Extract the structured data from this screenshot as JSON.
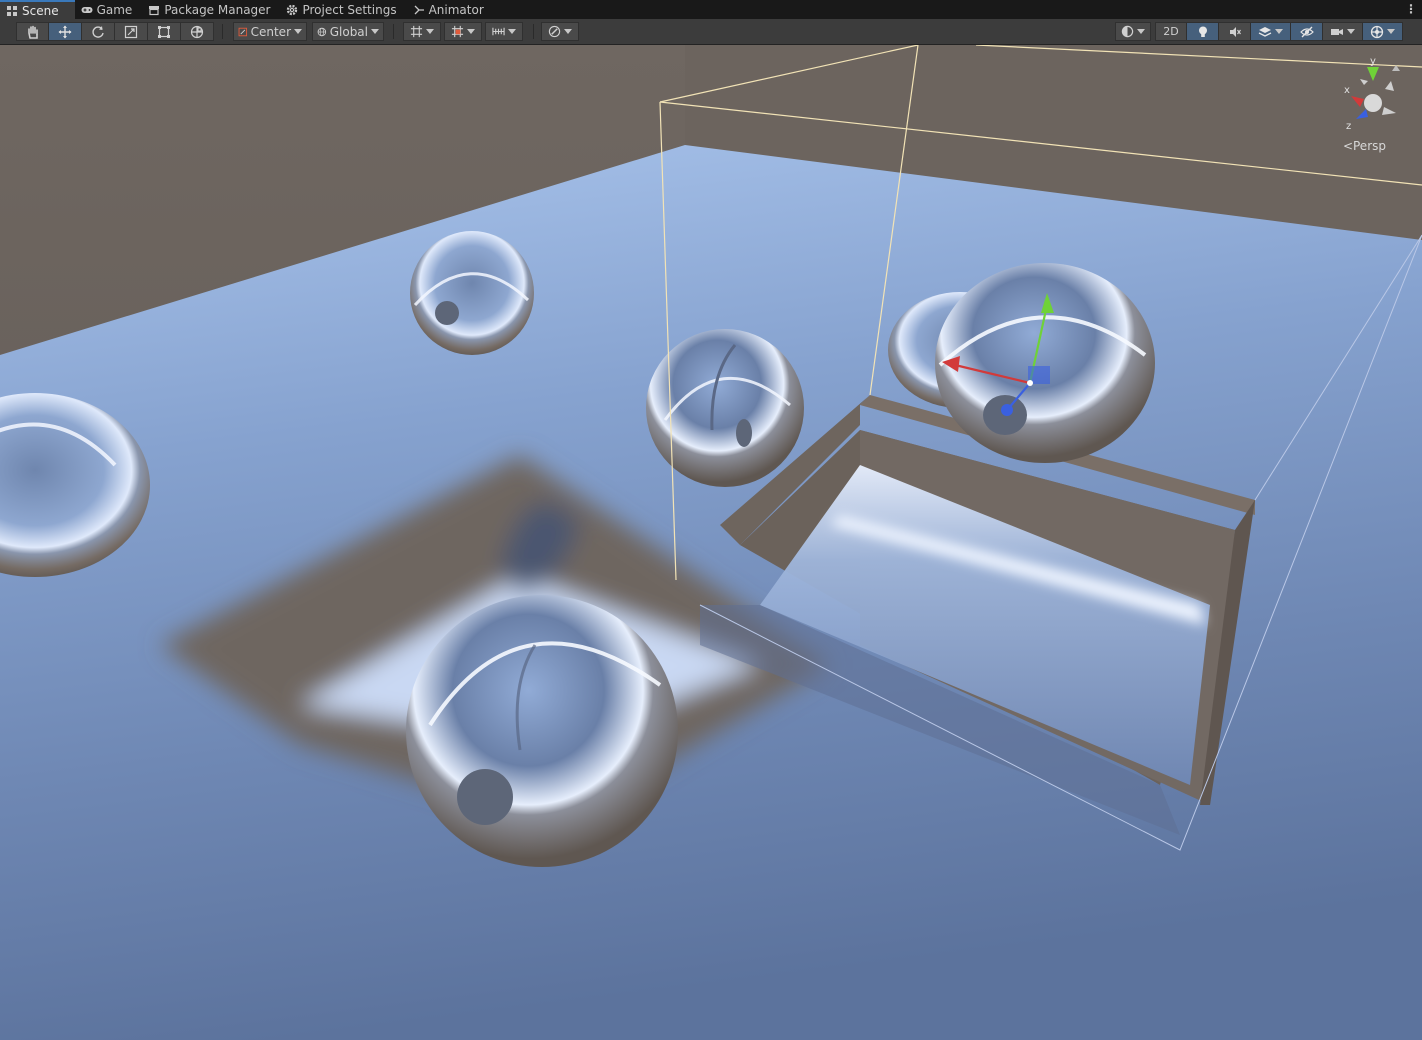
{
  "tabs": [
    {
      "label": "Scene",
      "icon": "scene-grid-icon",
      "active": true
    },
    {
      "label": "Game",
      "icon": "gamepad-icon",
      "active": false
    },
    {
      "label": "Package Manager",
      "icon": "package-icon",
      "active": false
    },
    {
      "label": "Project Settings",
      "icon": "gear-icon",
      "active": false
    },
    {
      "label": "Animator",
      "icon": "animator-icon",
      "active": false
    }
  ],
  "tab_menu": "⋮",
  "toolbar": {
    "tools": [
      "hand-tool-icon",
      "move-tool-icon",
      "rotate-tool-icon",
      "scale-tool-icon",
      "rect-tool-icon",
      "transform-tool-icon"
    ],
    "pivot_label": "Center",
    "space_label": "Global",
    "mode_2d_label": "2D"
  },
  "viewport": {
    "projection_label": "Persp",
    "axis_x": "x",
    "axis_y": "y",
    "axis_z": "z"
  },
  "colors": {
    "toolbar_bg": "#3c3c3c",
    "active_tool": "#46607c",
    "accent": "#3a79bb",
    "selection_outline": "#f2e3b6",
    "gizmo_x": "#d23a3a",
    "gizmo_y": "#6fd238",
    "gizmo_z": "#3a60e0"
  }
}
